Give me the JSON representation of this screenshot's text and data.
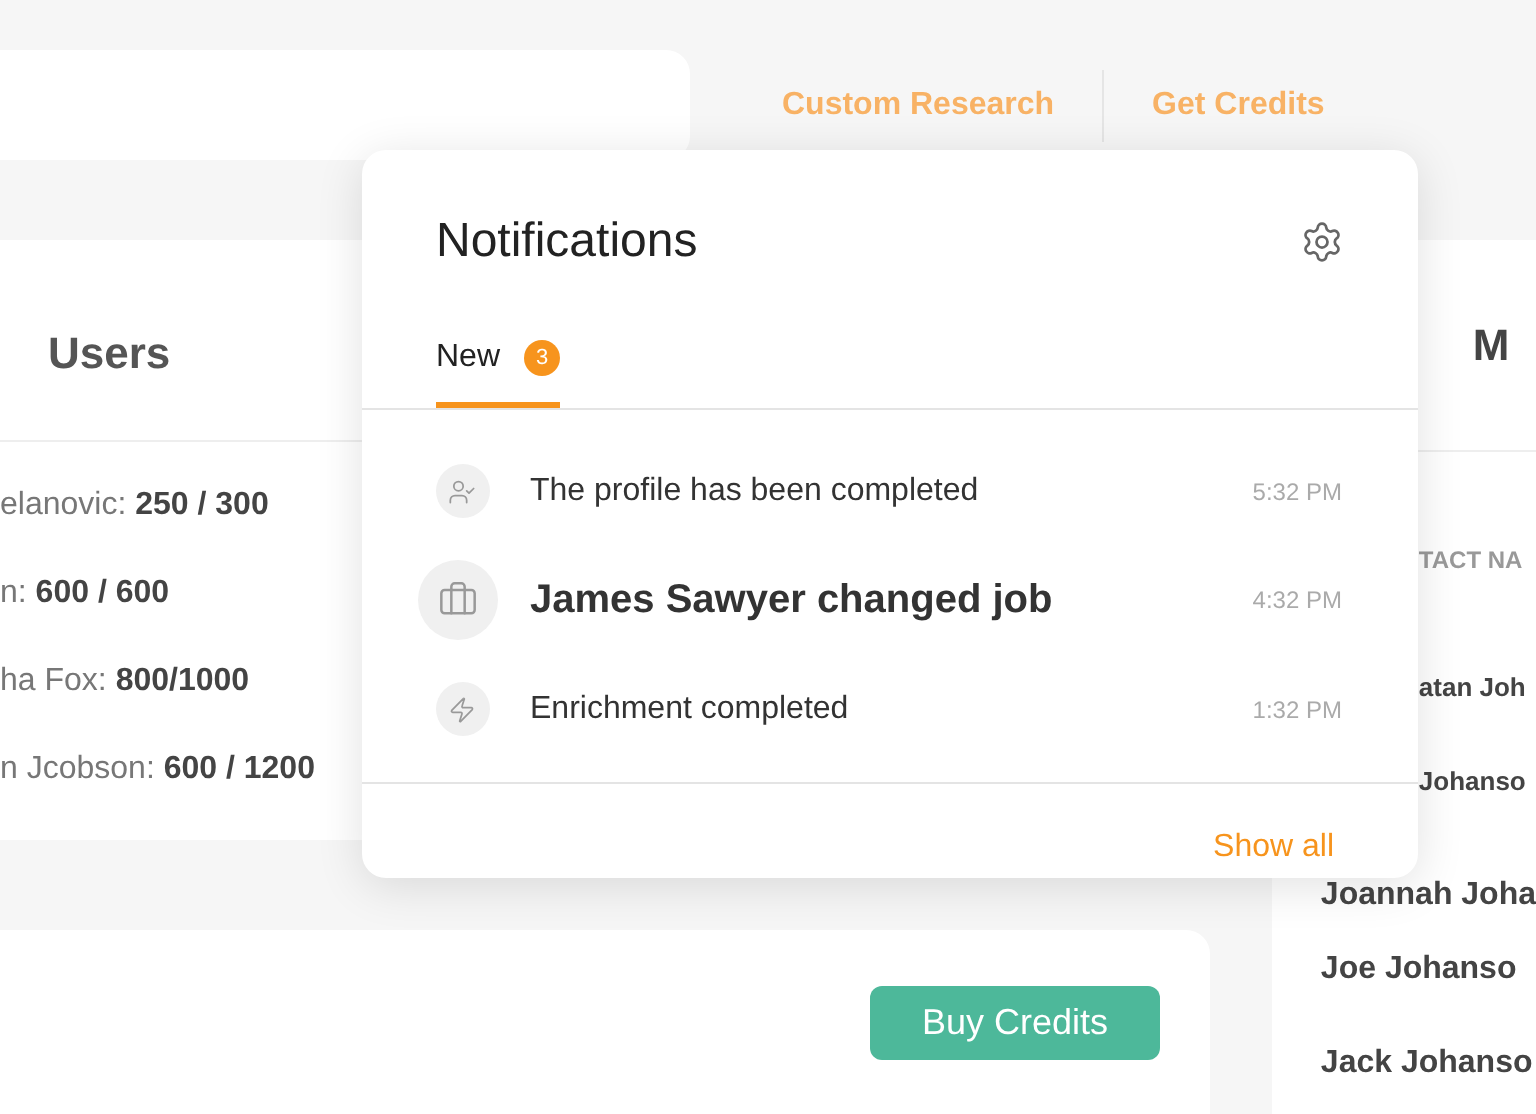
{
  "top_links": [
    "Custom Research",
    "Get Credits"
  ],
  "users_card": {
    "title": "Users",
    "rows": [
      {
        "label": "elanovic:",
        "value": "250 / 300"
      },
      {
        "label": "n:",
        "value": "600 / 600"
      },
      {
        "label": "ha Fox:",
        "value": "800/1000"
      },
      {
        "label": "n Jcobson:",
        "value": "600 / 1200"
      }
    ]
  },
  "contacts_card": {
    "title": "M",
    "column_1": "TACT NA",
    "rows": [
      "atan Joh",
      "Johanso",
      "Joannah Joha",
      "Joe Johanso",
      "Jack Johanso"
    ]
  },
  "credits_card": {
    "button": "Buy Credits"
  },
  "notifications": {
    "title": "Notifications",
    "tabs": [
      {
        "label": "New",
        "count": "3",
        "selected": true
      }
    ],
    "items": [
      {
        "kind": "profile",
        "text": "The profile has been completed",
        "time": "5:32 PM",
        "highlighted": false
      },
      {
        "kind": "job",
        "text": "James Sawyer changed job",
        "time": "4:32 PM",
        "highlighted": true
      },
      {
        "kind": "enrichment",
        "text": "Enrichment completed",
        "time": "1:32 PM",
        "highlighted": false
      }
    ],
    "footer_link": "Show all"
  }
}
